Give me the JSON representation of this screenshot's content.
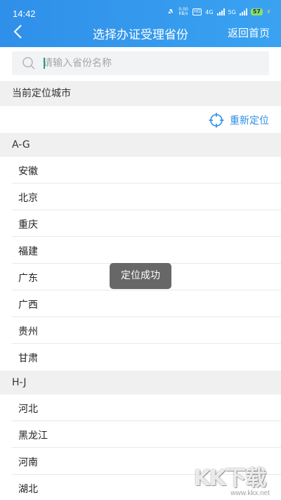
{
  "status_bar": {
    "time": "14:42",
    "net_speed_top": "0.00",
    "net_speed_bottom": "KB/s",
    "hd_label": "HD",
    "network_4g": "4G",
    "network_5g": "5G",
    "battery_level": "57"
  },
  "nav": {
    "title": "选择办证受理省份",
    "home_label": "返回首页"
  },
  "search": {
    "placeholder": "请输入省份名称",
    "value": ""
  },
  "location": {
    "section_label": "当前定位城市",
    "relocate_label": "重新定位"
  },
  "groups": [
    {
      "header": "A-G",
      "items": [
        "安徽",
        "北京",
        "重庆",
        "福建",
        "广东",
        "广西",
        "贵州",
        "甘肃"
      ]
    },
    {
      "header": "H-J",
      "items": [
        "河北",
        "黑龙江",
        "河南",
        "湖北"
      ]
    }
  ],
  "toast": {
    "message": "定位成功"
  },
  "watermark": {
    "main": "KK下载",
    "sub": "www.kkx.net"
  },
  "colors": {
    "header_blue": "#3aa3f1",
    "link_blue": "#2b8ee6",
    "section_gray": "#f0f0f0"
  }
}
